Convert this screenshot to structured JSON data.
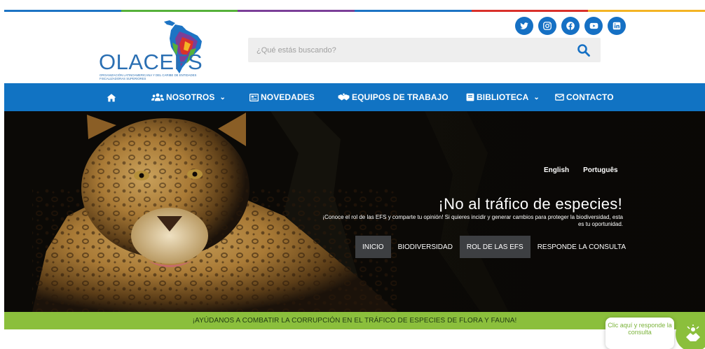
{
  "strip_colors": [
    "#1d74c4",
    "#56b13a",
    "#7b3f98",
    "#1d74c4",
    "#d9312b",
    "#f4b424"
  ],
  "logo": {
    "name": "OLACEFS",
    "subtitle": "Organización Latinoamericana y del Caribe de Entidades Fiscalizadoras Superiores"
  },
  "search": {
    "placeholder": "¿Qué estás buscando?"
  },
  "socials": [
    {
      "icon": "twitter-icon"
    },
    {
      "icon": "instagram-icon"
    },
    {
      "icon": "facebook-icon"
    },
    {
      "icon": "youtube-icon"
    },
    {
      "icon": "linkedin-icon"
    }
  ],
  "nav": {
    "home_icon": "home-icon",
    "items": [
      {
        "label": "NOSOTROS",
        "icon": "users-icon",
        "dropdown": true
      },
      {
        "label": "NOVEDADES",
        "icon": "newspaper-icon",
        "dropdown": false
      },
      {
        "label": "EQUIPOS DE TRABAJO",
        "icon": "handshake-icon",
        "dropdown": false
      },
      {
        "label": "BIBLIOTECA",
        "icon": "book-icon",
        "dropdown": true
      },
      {
        "label": "CONTACTO",
        "icon": "envelope-icon",
        "dropdown": false
      }
    ]
  },
  "hero": {
    "languages": [
      "English",
      "Português"
    ],
    "title": "¡No al tráfico de especies!",
    "text": "¡Conoce el rol de las EFS y comparte tu opinión! Si quieres incidir y generar cambios para proteger la biodiversidad, esta es tu oportunidad.",
    "buttons": [
      {
        "label": "INICIO",
        "style": "dark"
      },
      {
        "label": "BIODIVERSIDAD",
        "style": "plain"
      },
      {
        "label": "ROL DE LAS EFS",
        "style": "dark"
      },
      {
        "label": "RESPONDE LA CONSULTA",
        "style": "plain"
      }
    ]
  },
  "banner": {
    "text": "¡AYÚDANOS A COMBATIR LA CORRUPCIÓN EN EL TRÁFICO DE ESPECIES DE FLORA Y FAUNA!"
  },
  "float_button": {
    "text": "Clic aquí y responde la consulta",
    "icon": "hands-icon"
  },
  "colors": {
    "brand_blue": "#1173c3",
    "banner_green": "#8bbf3c"
  }
}
